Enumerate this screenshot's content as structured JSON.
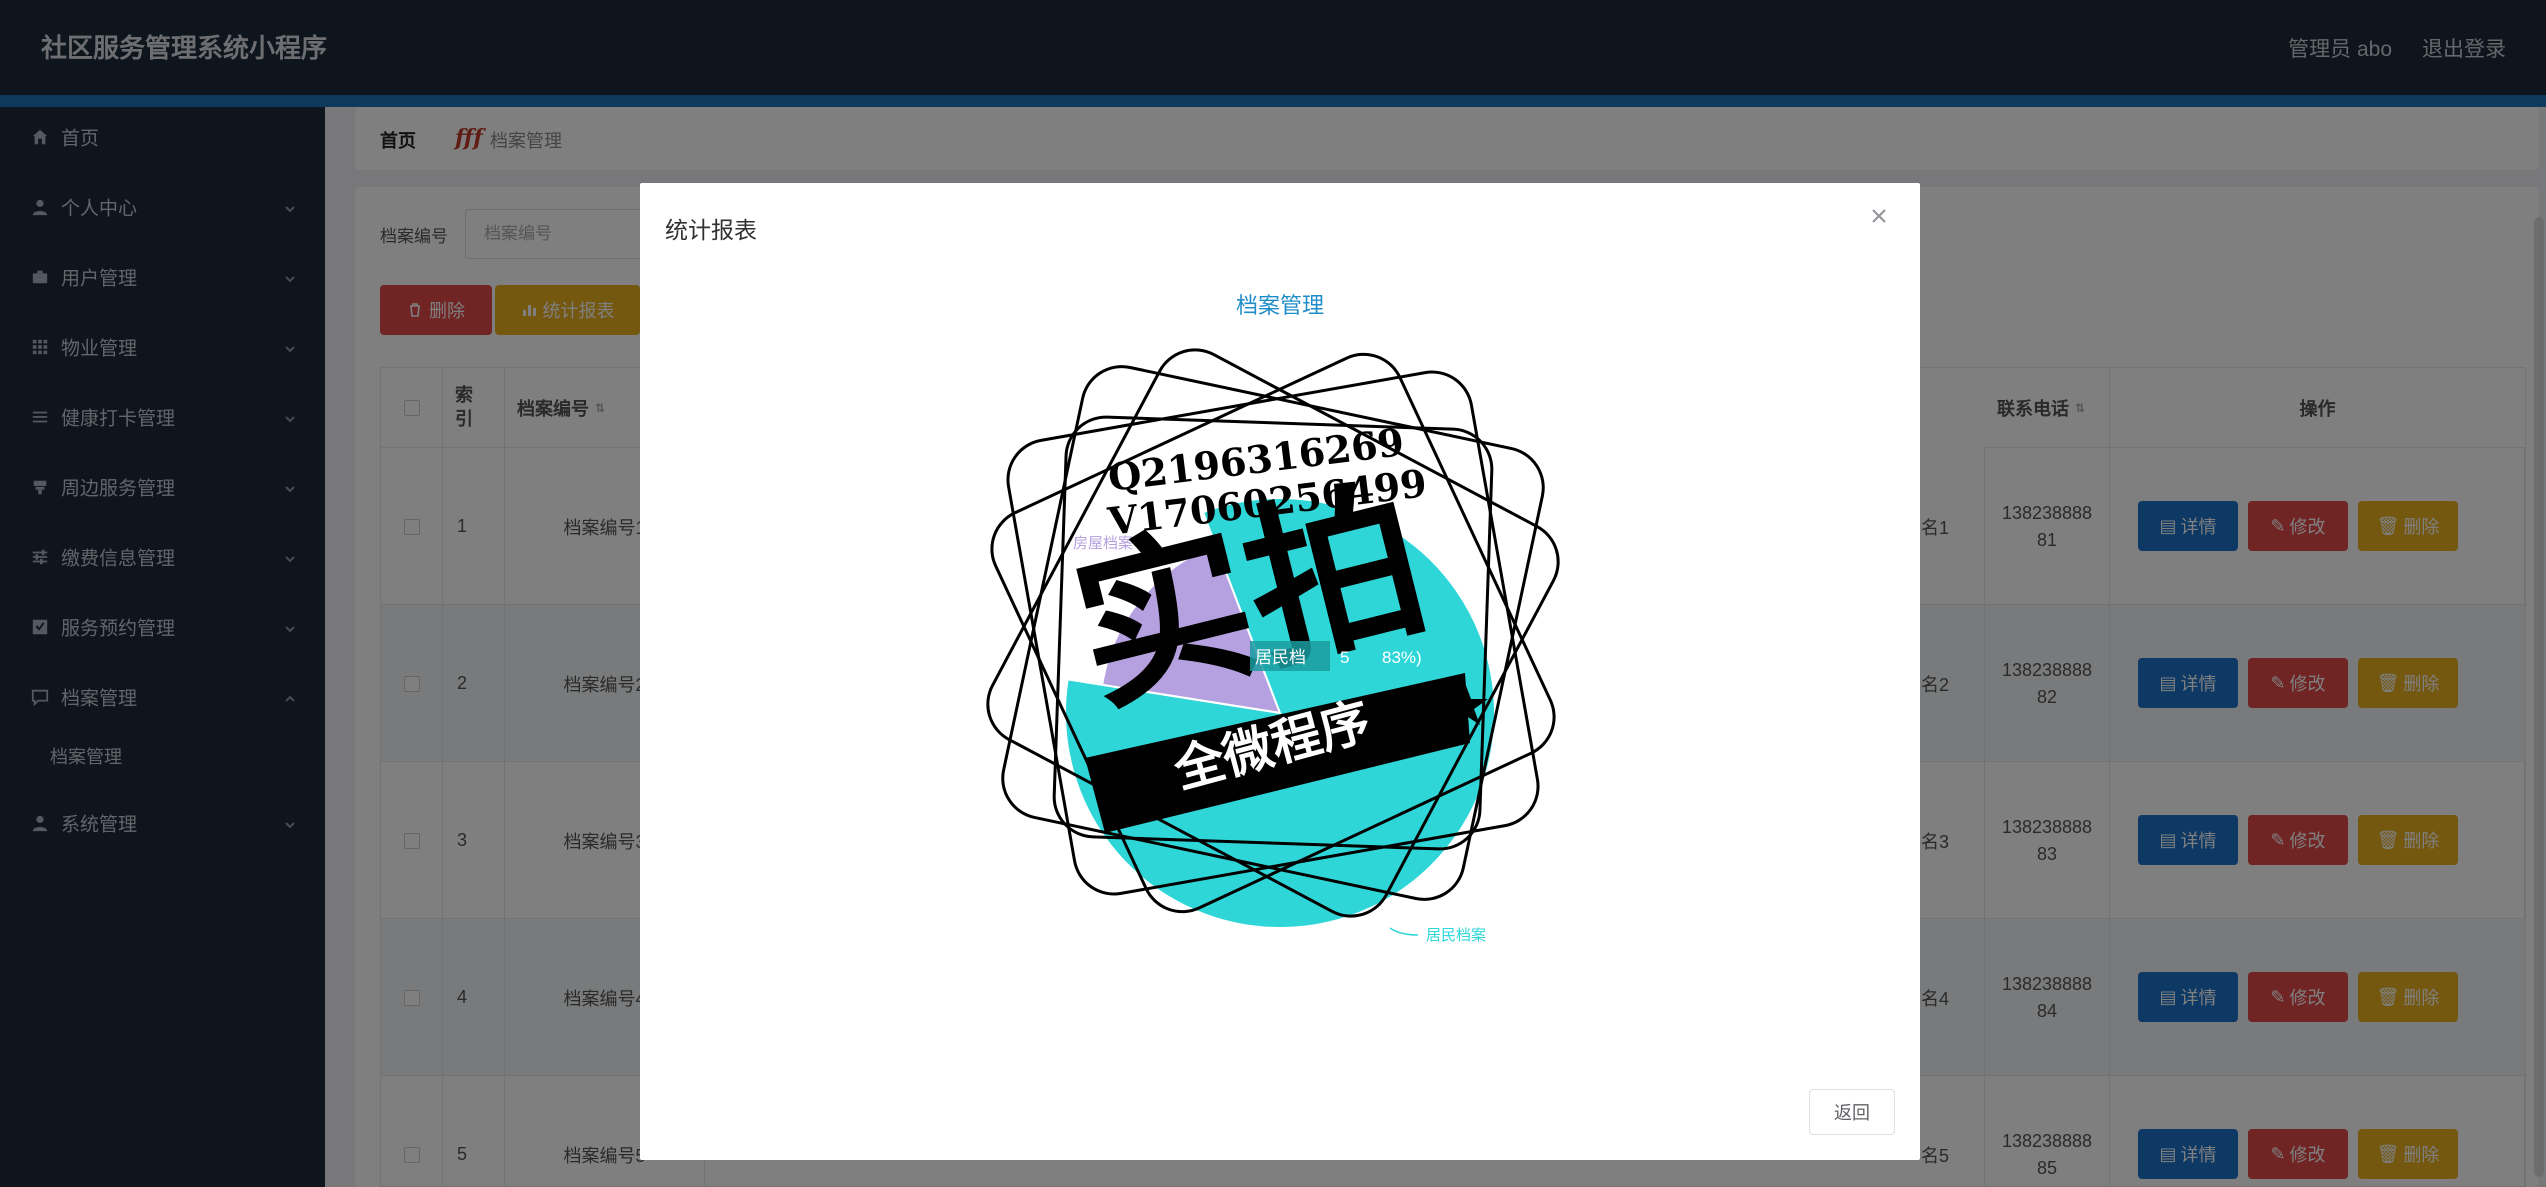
{
  "header": {
    "app_title": "社区服务管理系统小程序",
    "admin_label": "管理员 abo",
    "logout_label": "退出登录"
  },
  "sidebar": {
    "items": [
      {
        "label": "首页",
        "icon": "home-icon"
      },
      {
        "label": "个人中心",
        "icon": "user-icon"
      },
      {
        "label": "用户管理",
        "icon": "briefcase-icon"
      },
      {
        "label": "物业管理",
        "icon": "grid-icon"
      },
      {
        "label": "健康打卡管理",
        "icon": "list-icon"
      },
      {
        "label": "周边服务管理",
        "icon": "store-icon"
      },
      {
        "label": "缴费信息管理",
        "icon": "sliders-icon"
      },
      {
        "label": "服务预约管理",
        "icon": "check-square-icon"
      },
      {
        "label": "档案管理",
        "icon": "chat-icon"
      },
      {
        "label": "系统管理",
        "icon": "user-icon"
      }
    ],
    "sub_item": "档案管理"
  },
  "breadcrumb": {
    "home": "首页",
    "separator": "fff",
    "current": "档案管理"
  },
  "search": {
    "label": "档案编号",
    "placeholder": "档案编号"
  },
  "toolbar": {
    "delete_label": "删除",
    "stats_label": "统计报表"
  },
  "table": {
    "headers": {
      "index": "索引",
      "code": "档案编号",
      "phone": "联系电话",
      "actions": "操作"
    },
    "rows": [
      {
        "index": "1",
        "code": "档案编号1",
        "name_tail": "名1",
        "phone": "13823888881"
      },
      {
        "index": "2",
        "code": "档案编号2",
        "name_tail": "名2",
        "phone": "13823888882"
      },
      {
        "index": "3",
        "code": "档案编号3",
        "name_tail": "名3",
        "phone": "13823888883"
      },
      {
        "index": "4",
        "code": "档案编号4",
        "name_tail": "名4",
        "phone": "13823888884"
      },
      {
        "index": "5",
        "code": "档案编号5",
        "name_tail": "名5",
        "phone": "13823888885"
      }
    ],
    "action_labels": {
      "detail": "详情",
      "edit": "修改",
      "delete": "删除"
    }
  },
  "modal": {
    "title": "统计报表",
    "back_label": "返回",
    "watermark": {
      "line1": "Q2196316269",
      "line2": "V17060256499",
      "big": "实拍",
      "banner": "全微程序"
    }
  },
  "chart_data": {
    "type": "pie",
    "title": "档案管理",
    "slices": [
      {
        "name": "居民档案",
        "value": 5,
        "percent": "83%",
        "color": "#2fd6d8"
      },
      {
        "name": "房屋档案",
        "value": 1,
        "percent": "17%",
        "color": "#b5a0e0"
      }
    ],
    "highlight_label": "居民档",
    "highlight_value": "5",
    "highlight_percent": "83%)",
    "legend_labels": {
      "outer_right": "居民档案",
      "outer_left": "房屋档案"
    }
  },
  "colors": {
    "topbar": "#1e2a3a",
    "accent": "#1a73b8",
    "danger": "#e04848",
    "warning": "#e8b020",
    "primary": "#1a73c8"
  }
}
